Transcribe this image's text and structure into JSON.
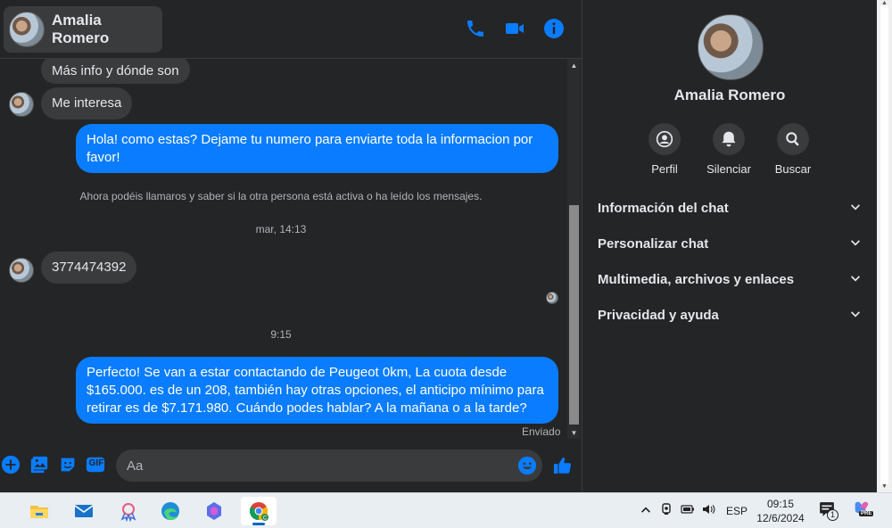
{
  "header": {
    "contact_name": "Amalia Romero",
    "icons": [
      "phone-icon",
      "video-icon",
      "info-icon"
    ]
  },
  "messages": [
    {
      "id": "m1",
      "direction": "in",
      "text": "Más info y dónde son"
    },
    {
      "id": "m2",
      "direction": "in",
      "text": "Me interesa"
    },
    {
      "id": "m3",
      "direction": "out",
      "text": "Hola! como estas? Dejame tu numero para enviarte toda la informacion por favor!"
    },
    {
      "id": "m4",
      "direction": "system",
      "text": "Ahora podéis llamaros y saber si la otra persona está activa o ha leído los mensajes."
    },
    {
      "id": "m5",
      "direction": "timestamp",
      "text": "mar, 14:13"
    },
    {
      "id": "m6",
      "direction": "in",
      "text": "3774474392"
    },
    {
      "id": "m7",
      "direction": "timestamp",
      "text": "9:15"
    },
    {
      "id": "m8",
      "direction": "out",
      "text": "Perfecto!  Se van a estar contactando de Peugeot 0km, La cuota desde $165.000. es de un 208, también hay otras opciones, el anticipo mínimo para retirar es de $7.171.980. Cuándo podes hablar? A la mañana o a la tarde?"
    }
  ],
  "status": {
    "sent_label": "Enviado"
  },
  "composer": {
    "placeholder": "Aa",
    "value": "",
    "icons": [
      "plus-icon",
      "image-icon",
      "sticker-icon",
      "gif-icon",
      "emoji-icon",
      "thumbs-up-icon"
    ],
    "gif_label": "GIF"
  },
  "panel": {
    "name": "Amalia Romero",
    "actions": [
      {
        "label": "Perfil",
        "icon": "profile-icon"
      },
      {
        "label": "Silenciar",
        "icon": "bell-icon"
      },
      {
        "label": "Buscar",
        "icon": "search-icon"
      }
    ],
    "sections": [
      {
        "label": "Información del chat"
      },
      {
        "label": "Personalizar chat"
      },
      {
        "label": "Multimedia, archivos y enlaces"
      },
      {
        "label": "Privacidad y ayuda"
      }
    ]
  },
  "taskbar": {
    "apps": [
      "file-explorer-icon",
      "mail-icon",
      "ribbon-app-icon",
      "edge-icon",
      "copilot-icon",
      "chrome-icon"
    ],
    "active_app": "chrome-icon",
    "language": "ESP",
    "time": "09:15",
    "date": "12/6/2024",
    "notification_count": "1",
    "copilot_badge": "PRE"
  },
  "colors": {
    "background": "#242526",
    "bubble_in": "#3a3b3c",
    "bubble_out": "#0a7cff",
    "accent": "#0a7cff",
    "taskbar": "#e9eef3"
  }
}
